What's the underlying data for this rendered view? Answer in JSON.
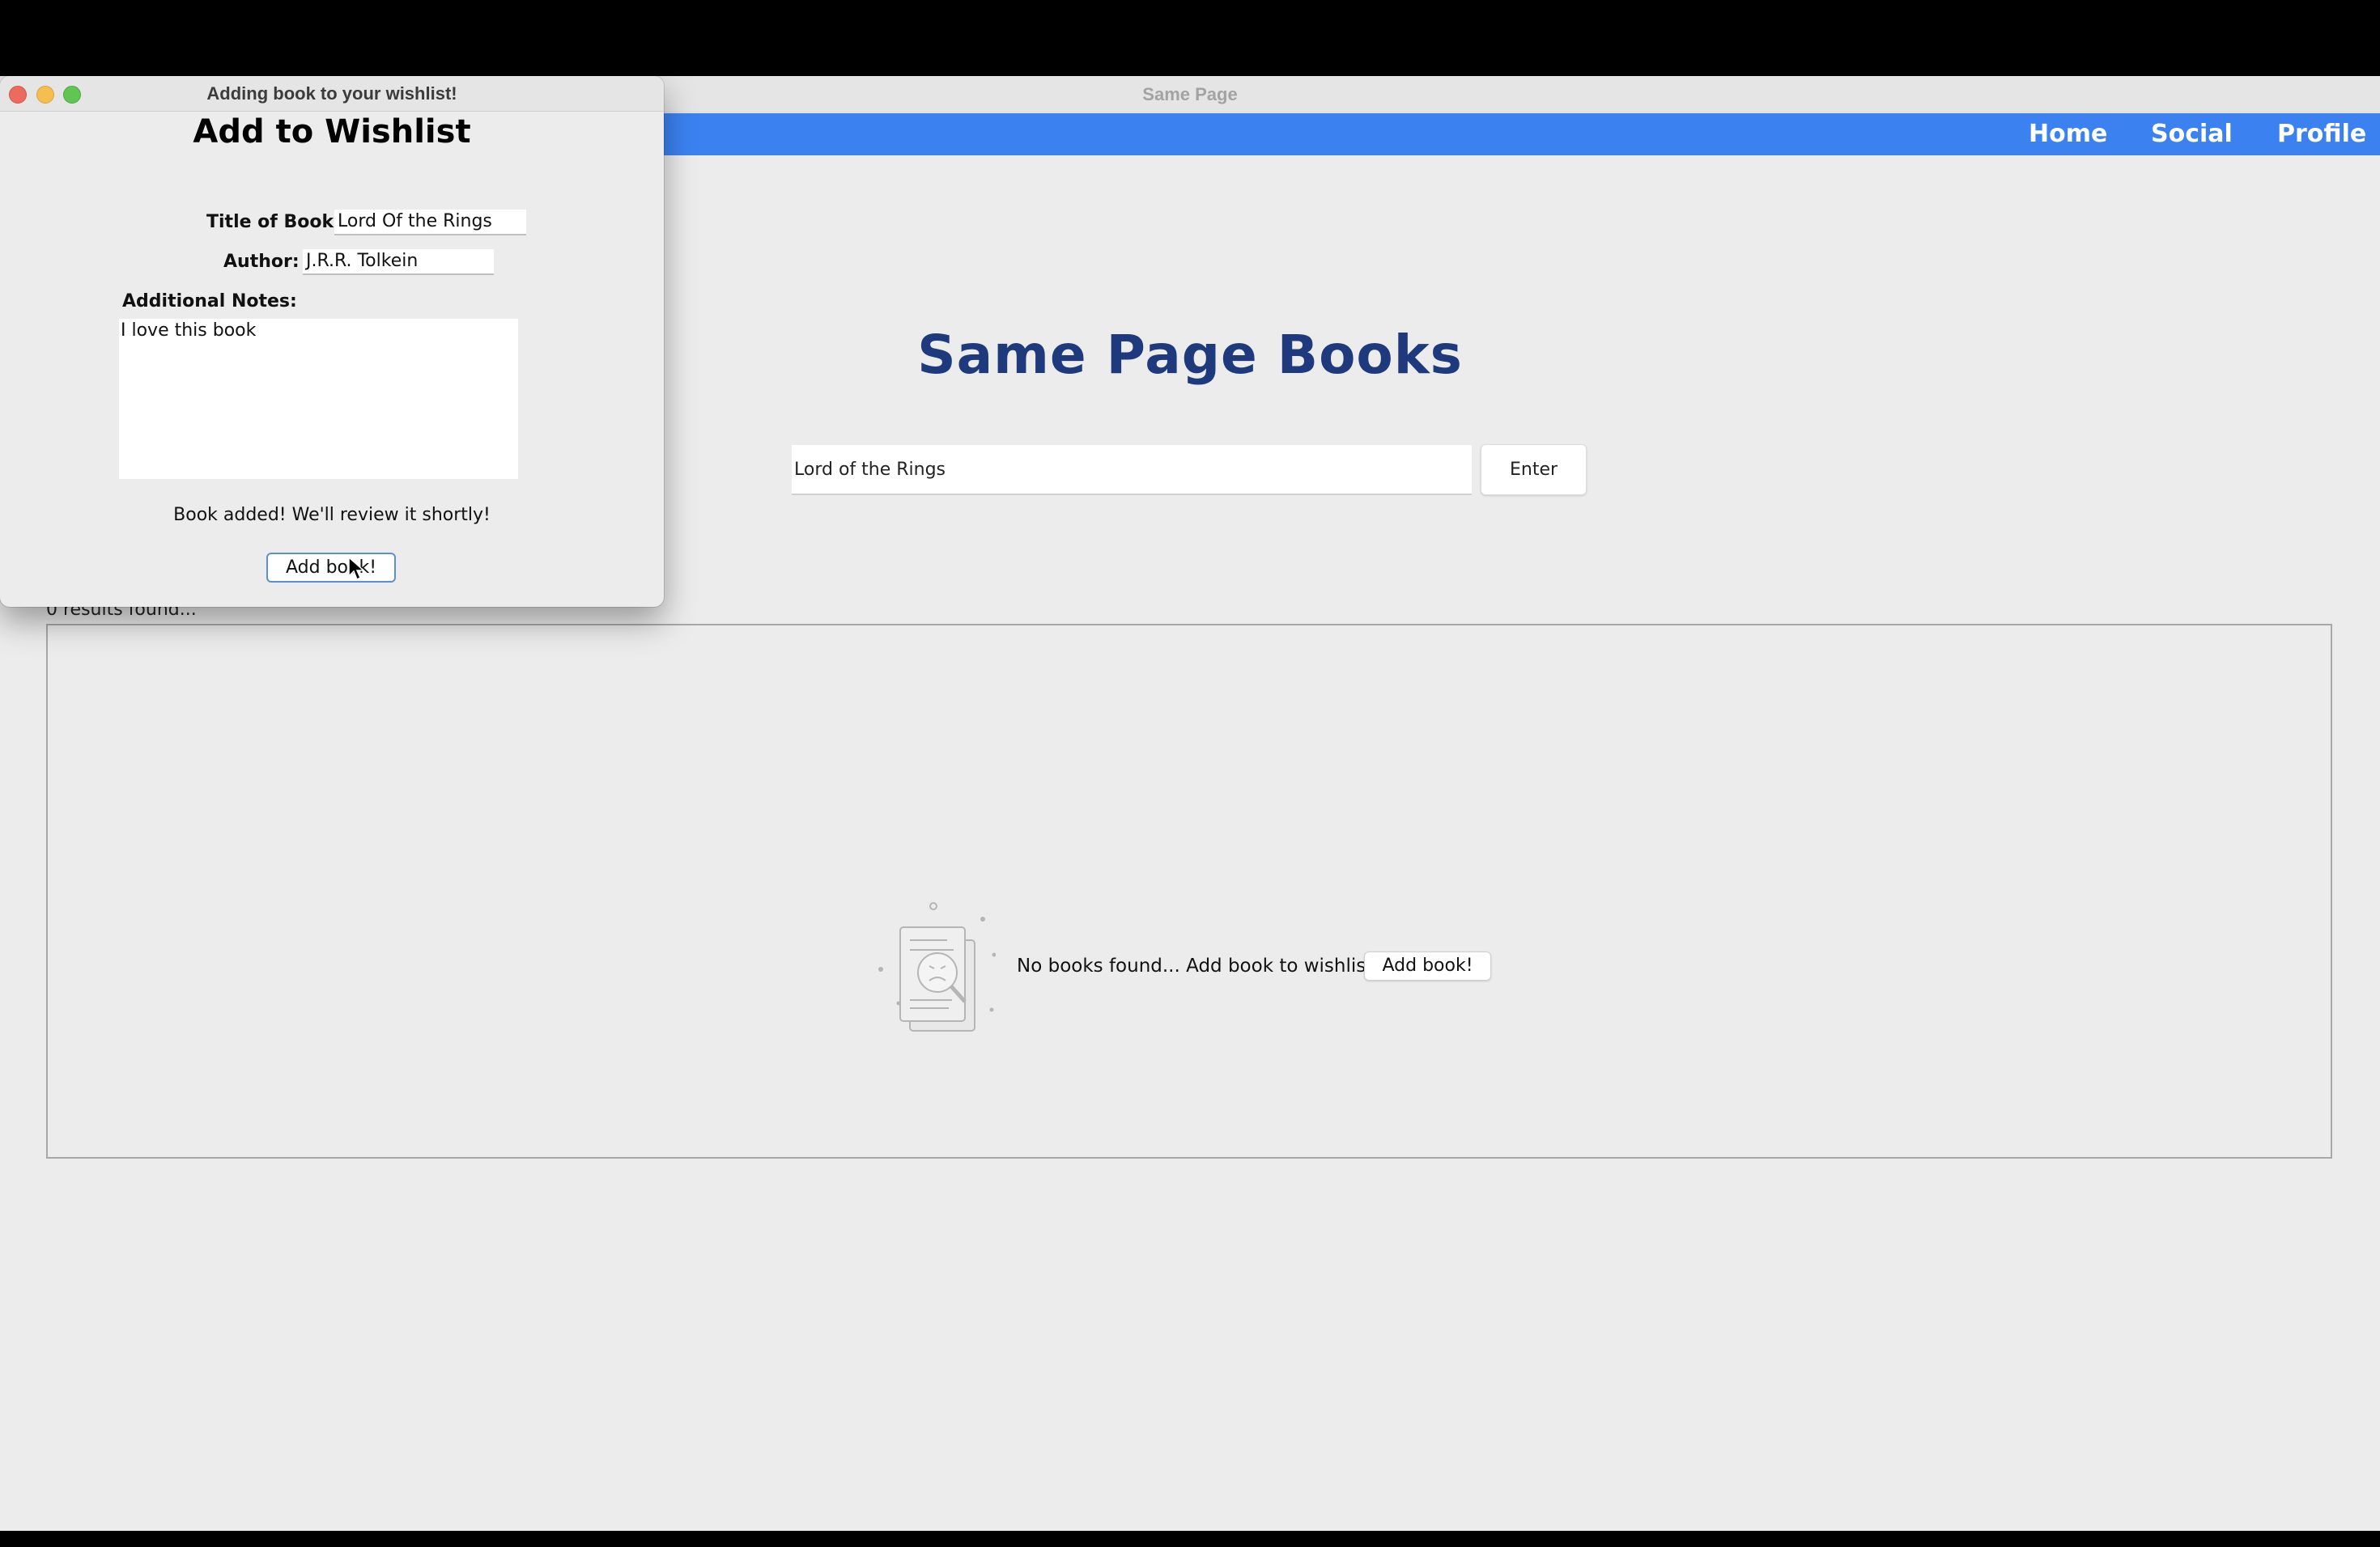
{
  "main_window": {
    "title": "Same Page",
    "nav": {
      "home": "Home",
      "social": "Social",
      "profile": "Profile"
    },
    "hero_title": "Same Page Books",
    "search": {
      "value": "Lord of the Rings",
      "button_label": "Enter"
    },
    "results_count": "0 results found...",
    "empty_state": {
      "icon": "no-results-magnifier-document-icon",
      "message": "No books found... Add book to wishlist?",
      "button_label": "Add book!"
    }
  },
  "dialog": {
    "window_title": "Adding book to your wishlist!",
    "heading": "Add to Wishlist",
    "title_label": "Title of Book:",
    "title_value": "Lord Of the Rings",
    "author_label": "Author:",
    "author_value": "J.R.R. Tolkein",
    "notes_label": "Additional Notes:",
    "notes_value": "I love this book",
    "status_message": "Book added! We'll review it shortly!",
    "button_label": "Add book!"
  },
  "colors": {
    "navbar": "#3b82f0",
    "hero_title": "#1e3a7d",
    "window_bg": "#ececec"
  }
}
